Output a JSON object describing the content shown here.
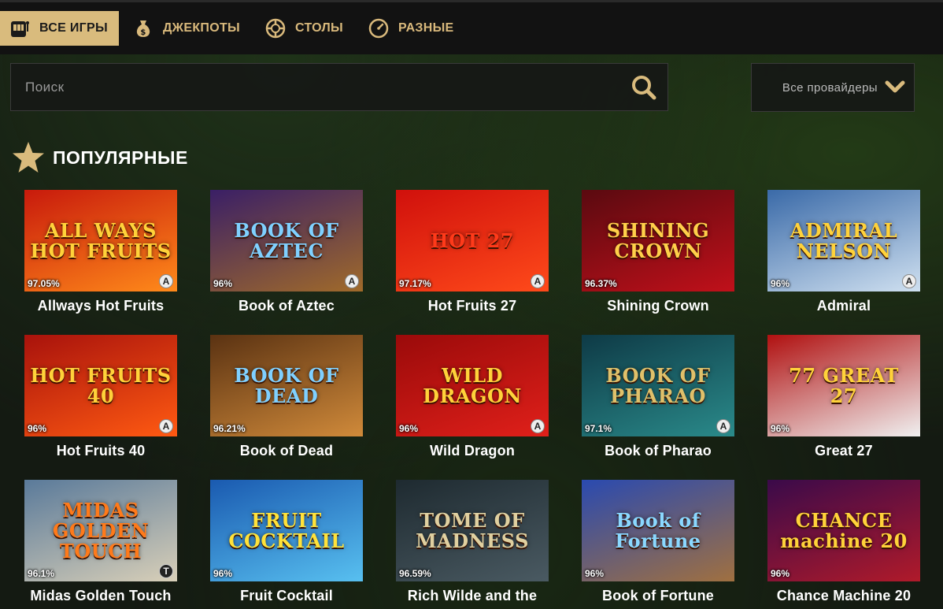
{
  "nav": {
    "tabs": [
      {
        "label": "ВСЕ ИГРЫ",
        "icon": "slot-machine-icon",
        "active": true
      },
      {
        "label": "ДЖЕКПОТЫ",
        "icon": "money-bag-icon",
        "active": false
      },
      {
        "label": "СТОЛЫ",
        "icon": "casino-chip-icon",
        "active": false
      },
      {
        "label": "РАЗНЫЕ",
        "icon": "dial-icon",
        "active": false
      }
    ]
  },
  "search": {
    "placeholder": "Поиск",
    "value": "",
    "icon": "search-icon"
  },
  "providers": {
    "label": "Все провайдеры",
    "icon": "chevron-down-icon"
  },
  "section": {
    "title": "ПОПУЛЯРНЫЕ",
    "icon": "star-icon"
  },
  "games": [
    {
      "name": "Allways Hot Fruits",
      "rtp": "97.05%",
      "logo": "ALL WAYS HOT FRUITS",
      "badge": "A",
      "bg": [
        "#c81a0c",
        "#ff8a1a"
      ],
      "logo_color": "#ffd23a"
    },
    {
      "name": "Book of Aztec",
      "rtp": "96%",
      "logo": "BOOK OF AZTEC",
      "badge": "A",
      "bg": [
        "#3a1f66",
        "#a06a2a"
      ],
      "logo_color": "#7fd0ff"
    },
    {
      "name": "Hot Fruits 27",
      "rtp": "97.17%",
      "logo": "HOT 27",
      "badge": "A",
      "bg": [
        "#d0100c",
        "#ff4a1a"
      ],
      "logo_color": "#ff3a1a"
    },
    {
      "name": "Shining Crown",
      "rtp": "96.37%",
      "logo": "SHINING CROWN",
      "badge": "",
      "bg": [
        "#5a0a10",
        "#c0101a"
      ],
      "logo_color": "#ffcf4a"
    },
    {
      "name": "Admiral",
      "rtp": "96%",
      "logo": "ADMIRAL NELSON",
      "badge": "A",
      "bg": [
        "#3a6aa8",
        "#cfe0f0"
      ],
      "logo_color": "#ffd23a"
    },
    {
      "name": "Hot Fruits 40",
      "rtp": "96%",
      "logo": "HOT FRUITS 40",
      "badge": "A",
      "bg": [
        "#a8120c",
        "#ff5a12"
      ],
      "logo_color": "#ffd23a"
    },
    {
      "name": "Book of Dead",
      "rtp": "96.21%",
      "logo": "BOOK OF DEAD",
      "badge": "",
      "bg": [
        "#5a3212",
        "#d08a3a"
      ],
      "logo_color": "#7fd0ff"
    },
    {
      "name": "Wild Dragon",
      "rtp": "96%",
      "logo": "WILD DRAGON",
      "badge": "A",
      "bg": [
        "#9a0a0a",
        "#e0201a"
      ],
      "logo_color": "#ffd23a"
    },
    {
      "name": "Book of Pharao",
      "rtp": "97.1%",
      "logo": "BOOK OF PHARAO",
      "badge": "A",
      "bg": [
        "#0e3a46",
        "#2a8a8a"
      ],
      "logo_color": "#e0c06a"
    },
    {
      "name": "Great 27",
      "rtp": "96%",
      "logo": "77 GREAT 27",
      "badge": "",
      "bg": [
        "#b01010",
        "#f0f0f0"
      ],
      "logo_color": "#ffd23a"
    },
    {
      "name": "Midas Golden Touch",
      "rtp": "96.1%",
      "logo": "MIDAS GOLDEN TOUCH",
      "badge": "T",
      "bg": [
        "#5a7a9a",
        "#d8cfb8"
      ],
      "logo_color": "#ff7a1a"
    },
    {
      "name": "Fruit Cocktail",
      "rtp": "96%",
      "logo": "FRUIT COCKTAIL",
      "badge": "",
      "bg": [
        "#1a5ab0",
        "#58c0f0"
      ],
      "logo_color": "#ffe23a"
    },
    {
      "name": "Rich Wilde and the",
      "rtp": "96.59%",
      "logo": "TOME OF MADNESS",
      "badge": "",
      "bg": [
        "#1e2a30",
        "#4a5a62"
      ],
      "logo_color": "#e0d0a0"
    },
    {
      "name": "Book of Fortune",
      "rtp": "96%",
      "logo": "Book of Fortune",
      "badge": "",
      "bg": [
        "#2a4ab0",
        "#a07040"
      ],
      "logo_color": "#8ad8ff"
    },
    {
      "name": "Chance Machine 20",
      "rtp": "96%",
      "logo": "CHANCE machine 20",
      "badge": "",
      "bg": [
        "#3a0a4a",
        "#b01a2a"
      ],
      "logo_color": "#ffd23a"
    }
  ],
  "colors": {
    "accent": "#d9bb7d",
    "nav_bg": "#121212",
    "gold": "#d9b97c"
  }
}
